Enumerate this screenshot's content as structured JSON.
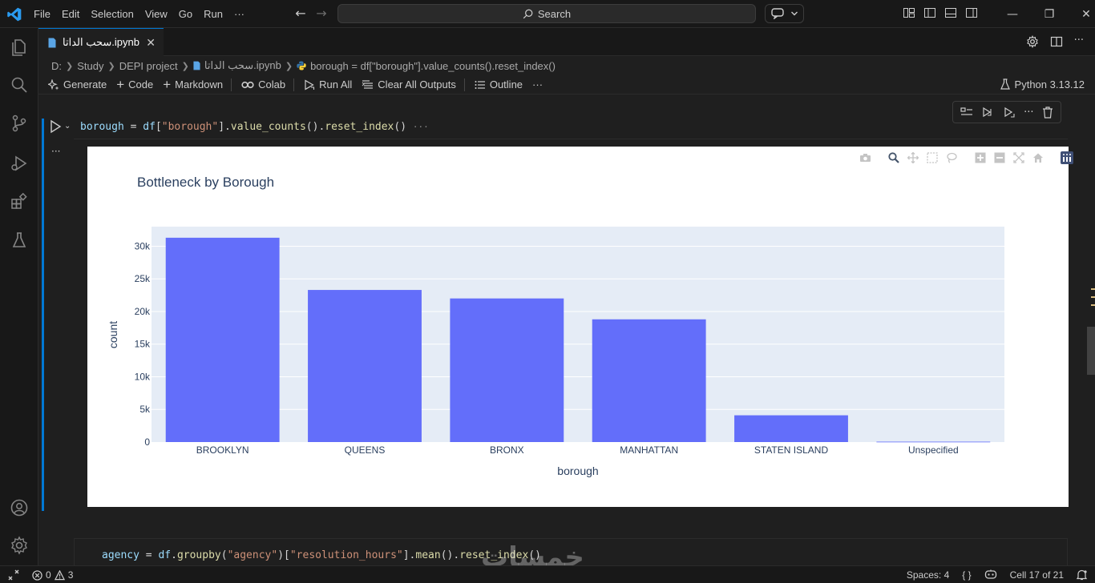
{
  "menu": [
    "File",
    "Edit",
    "Selection",
    "View",
    "Go",
    "Run",
    "···"
  ],
  "search": {
    "label": "Search"
  },
  "tab": {
    "title": "سحب الداتا.ipynb"
  },
  "breadcrumb": [
    "D:",
    "Study",
    "DEPI project",
    "سحب الداتا.ipynb",
    "borough = df[\"borough\"].value_counts().reset_index()"
  ],
  "toolbar": {
    "generate": "Generate",
    "code": "Code",
    "markdown": "Markdown",
    "colab": "Colab",
    "run_all": "Run All",
    "clear_outputs": "Clear All Outputs",
    "outline": "Outline",
    "more": "···",
    "kernel": "Python 3.13.12"
  },
  "cell1": {
    "code_var": "borough",
    "code_eq": " = ",
    "code_df": "df",
    "code_open": "[",
    "code_str": "\"borough\"",
    "code_close": "].",
    "code_fn1": "value_counts",
    "code_mid": "().",
    "code_fn2": "reset_index",
    "code_end": "()",
    "ellipsis": "···",
    "output_dots": "···"
  },
  "cell2": {
    "code_var": "agency",
    "code_eq": " = ",
    "code_df": "df",
    "code_dot": ".",
    "code_fn1": "groupby",
    "code_p1": "(",
    "code_str1": "\"agency\"",
    "code_p2": ")[",
    "code_str2": "\"resolution_hours\"",
    "code_p3": "].",
    "code_fn2": "mean",
    "code_p4": "().",
    "code_fn3": "reset_index",
    "code_p5": "()"
  },
  "watermark": "خمسات",
  "chart_data": {
    "type": "bar",
    "title": "Bottleneck by Borough",
    "xlabel": "borough",
    "ylabel": "count",
    "categories": [
      "BROOKLYN",
      "QUEENS",
      "BRONX",
      "MANHATTAN",
      "STATEN ISLAND",
      "Unspecified"
    ],
    "values": [
      31300,
      23300,
      22000,
      18800,
      4100,
      60
    ],
    "ylim": [
      0,
      33000
    ],
    "yticks": [
      0,
      5000,
      10000,
      15000,
      20000,
      25000,
      30000
    ],
    "ytick_labels": [
      "0",
      "5k",
      "10k",
      "15k",
      "20k",
      "25k",
      "30k"
    ],
    "grid": true,
    "bar_color": "#636efa",
    "plot_bg": "#e5ecf6"
  },
  "status": {
    "errors": "0",
    "warnings": "3",
    "spaces": "Spaces: 4",
    "braces": "{ }",
    "cell": "Cell 17 of 21"
  },
  "colors": {
    "accent": "#0078d4"
  }
}
